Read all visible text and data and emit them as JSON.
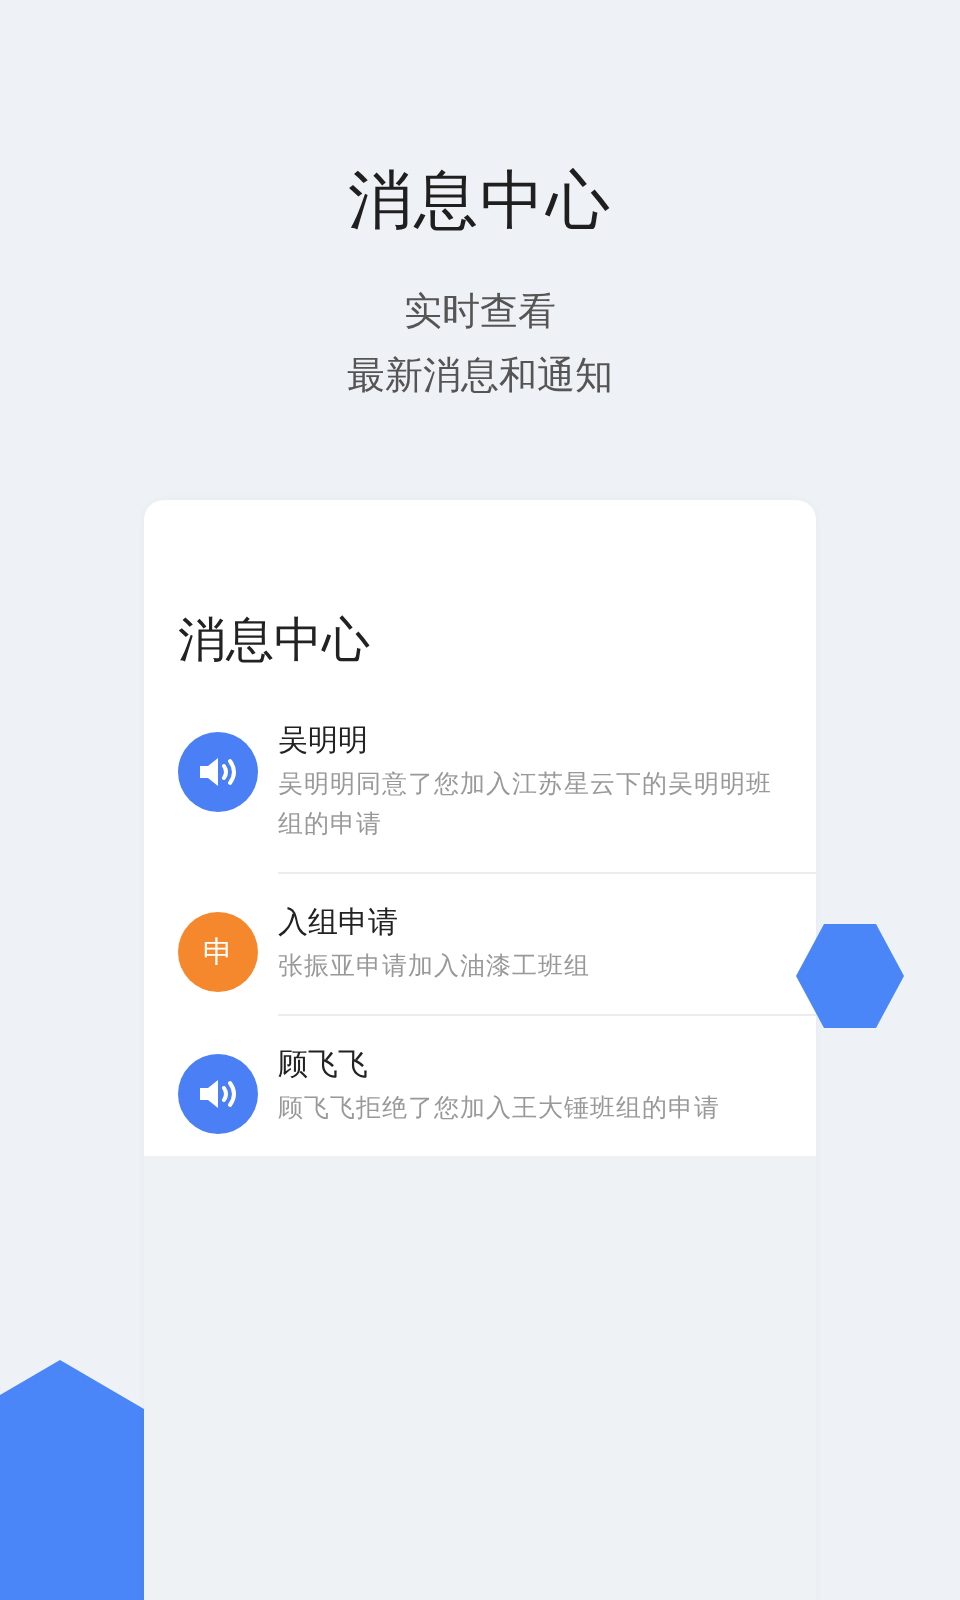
{
  "header": {
    "title": "消息中心",
    "subtitle_lines": [
      "实时查看",
      "最新消息和通知"
    ]
  },
  "card": {
    "title": "消息中心",
    "messages": [
      {
        "kind": "speaker",
        "color": "#4a7ff5",
        "name": "吴明明",
        "text": "吴明明同意了您加入江苏星云下的吴明明班组的申请"
      },
      {
        "kind": "letter",
        "color": "#f5882c",
        "avatar_text": "申",
        "name": "入组申请",
        "text": "张振亚申请加入油漆工班组"
      },
      {
        "kind": "speaker",
        "color": "#4a7ff5",
        "name": "顾飞飞",
        "text": "顾飞飞拒绝了您加入王大锤班组的申请"
      }
    ]
  }
}
